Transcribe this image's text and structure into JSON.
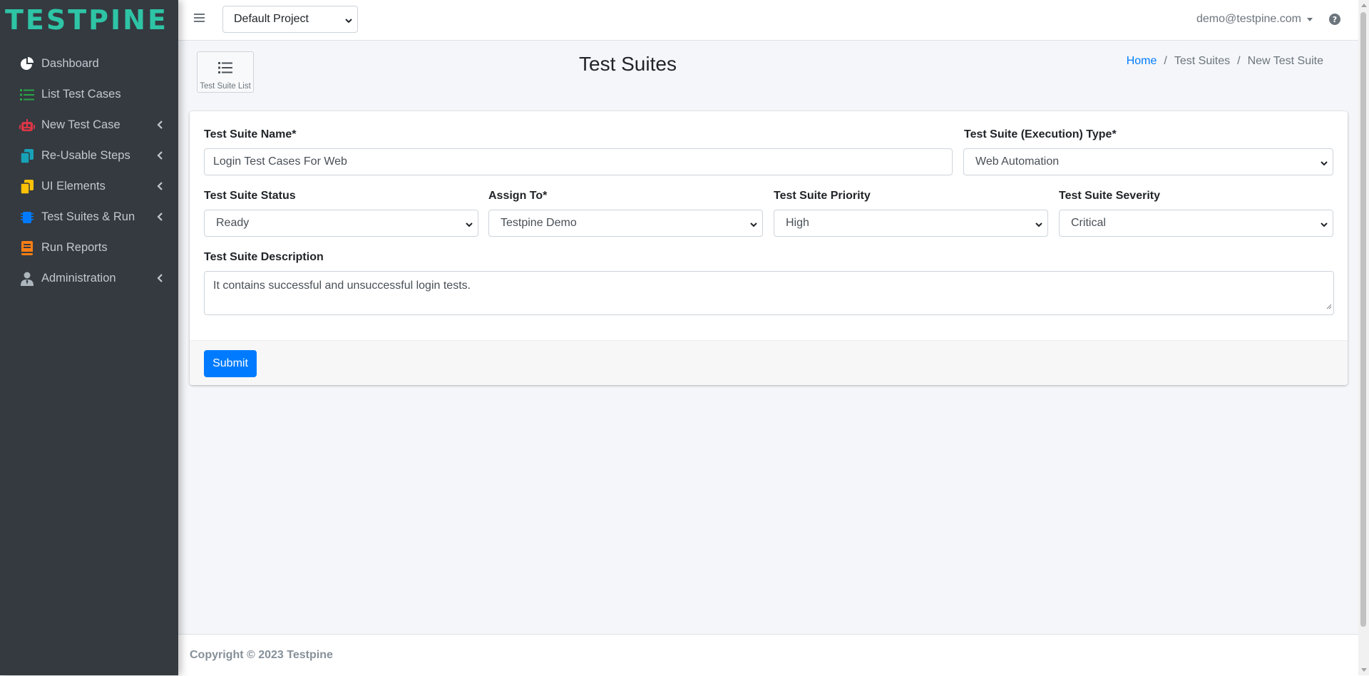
{
  "brand": {
    "name": "TESTPINE"
  },
  "sidebar": {
    "items": [
      {
        "label": "Dashboard",
        "icon": "pie-chart-icon",
        "color": "#ffffff",
        "submenu": false
      },
      {
        "label": "List Test Cases",
        "icon": "list-icon",
        "color": "#28a745",
        "submenu": false
      },
      {
        "label": "New Test Case",
        "icon": "robot-icon",
        "color": "#dc3545",
        "submenu": true
      },
      {
        "label": "Re-Usable Steps",
        "icon": "copy-icon",
        "color": "#17a2b8",
        "submenu": true
      },
      {
        "label": "UI Elements",
        "icon": "file-icon",
        "color": "#ffc107",
        "submenu": true
      },
      {
        "label": "Test Suites & Run",
        "icon": "chip-icon",
        "color": "#007bff",
        "submenu": true
      },
      {
        "label": "Run Reports",
        "icon": "book-icon",
        "color": "#fd7e14",
        "submenu": false
      },
      {
        "label": "Administration",
        "icon": "user-tie-icon",
        "color": "#adb5bd",
        "submenu": true
      }
    ]
  },
  "topbar": {
    "project_select": "Default Project",
    "user_email": "demo@testpine.com"
  },
  "header": {
    "list_button_label": "Test Suite List",
    "title": "Test Suites",
    "breadcrumb": [
      "Home",
      "Test Suites",
      "New Test Suite"
    ]
  },
  "form": {
    "name_label": "Test Suite Name*",
    "name_value": "Login Test Cases For Web",
    "type_label": "Test Suite (Execution) Type*",
    "type_value": "Web Automation",
    "status_label": "Test Suite Status",
    "status_value": "Ready",
    "assign_label": "Assign To*",
    "assign_value": "Testpine Demo",
    "priority_label": "Test Suite Priority",
    "priority_value": "High",
    "severity_label": "Test Suite Severity",
    "severity_value": "Critical",
    "description_label": "Test Suite Description",
    "description_value": "It contains successful and unsuccessful login tests.",
    "submit_label": "Submit"
  },
  "footer": {
    "copyright": "Copyright © 2023 Testpine"
  },
  "colors": {
    "accent": "#007bff",
    "brand": "#2ec4a6",
    "sidebar_bg": "#343a40"
  }
}
